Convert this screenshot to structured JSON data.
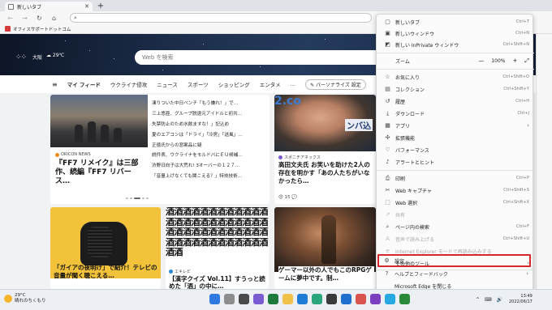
{
  "browser": {
    "tab_title": "新しいタブ",
    "tab_close": "✕",
    "new_tab": "+",
    "address_value": "",
    "nav": {
      "back": "←",
      "forward": "→",
      "refresh": "↻",
      "home": "⌂"
    },
    "favorites_bar": [
      {
        "label": "オフィスサポートドットコム"
      }
    ]
  },
  "hero": {
    "apps_glyph": "⁘⁘",
    "city": "大阪",
    "weather": "☁ 29℃",
    "search_placeholder": "Web を検索"
  },
  "feed_nav": {
    "menu_glyph": "≡",
    "items": [
      "マイ フィード",
      "ウクライナ侵攻",
      "ニュース",
      "スポーツ",
      "ショッピング",
      "エンタメ",
      "…"
    ],
    "personalize": "✎ パーソナライズ 設定"
  },
  "cards": {
    "ff7": {
      "source": "ORICON NEWS",
      "headline": "『FF7 リメイク』は三部作、続編『FF7 リバース…"
    },
    "news_list": [
      "凍りついた中日ベンチ「もう嫌れ！」で…",
      "三上悠亜、グループ脱退元アイドルと初共…",
      "失禁防止のため水飲ますな！」記込め",
      "夏のエアコンは「ドライ」「冷房」「送風」…",
      "正徳氏からの窓案品に疑",
      "説件表、ウクライナをモルドバにＥＵ候補…",
      "渋野日向子は大荒れ! 3オーバーの１２７…",
      "「音量上げなくても聞こえる？」特技技術…"
    ],
    "man": {
      "brand": "2.co",
      "sign": "ンバ込",
      "source": "スポニチアネックス",
      "headline": "高田文夫氏 お笑いを助けた2人の存在を明かす「あの人たちがいなかったら…",
      "reactions": "😍 15   💬"
    },
    "speaker": {
      "headline": "「ガイアの夜明け」で紹介！テレビの音量が聞く聴こえる…"
    },
    "kanji": {
      "pattern": "酒酒酒酒酒酒酒酒酒酒酒酒酒酒酒酒酒酒酒酒酒酒酒酒酒酒酒酒酒酒酒酒酒酒酒酒酒酒酒酒酒酒酒酒酒酒酒酒酒酒",
      "source": "エキレビ",
      "headline": "【漢字クイズ Vol.11】すうっと読めた「酒」の中に…"
    },
    "game": {
      "headline": "ゲーマー以外の人でもこのRPGゲームに夢中です。制…"
    }
  },
  "menu": {
    "items": [
      {
        "icon": "▢",
        "label": "新しいタブ",
        "shortcut": "Ctrl+T"
      },
      {
        "icon": "▣",
        "label": "新しいウィンドウ",
        "shortcut": "Ctrl+N"
      },
      {
        "icon": "◩",
        "label": "新しい InPrivate ウィンドウ",
        "shortcut": "Ctrl+Shift+N"
      },
      {
        "icon": "",
        "label": "ズーム",
        "zoom": "100%"
      },
      {
        "icon": "☆",
        "label": "お気に入り",
        "shortcut": "Ctrl+Shift+O"
      },
      {
        "icon": "▤",
        "label": "コレクション",
        "shortcut": "Ctrl+Shift+Y"
      },
      {
        "icon": "↺",
        "label": "履歴",
        "shortcut": "Ctrl+H"
      },
      {
        "icon": "⤓",
        "label": "ダウンロード",
        "shortcut": "Ctrl+J"
      },
      {
        "icon": "▦",
        "label": "アプリ",
        "arrow": "›"
      },
      {
        "icon": "✣",
        "label": "拡張機能"
      },
      {
        "icon": "♡",
        "label": "パフォーマンス"
      },
      {
        "icon": "♪",
        "label": "アラートとヒント"
      },
      {
        "icon": "⎙",
        "label": "印刷",
        "shortcut": "Ctrl+P"
      },
      {
        "icon": "✂",
        "label": "Web キャプチャ",
        "shortcut": "Ctrl+Shift+S"
      },
      {
        "icon": "⬚",
        "label": "Web 選択",
        "shortcut": "Ctrl+Shift+X"
      },
      {
        "icon": "↗",
        "label": "共有",
        "disabled": true
      },
      {
        "icon": "⌕",
        "label": "ページ内の検索",
        "shortcut": "Ctrl+F"
      },
      {
        "icon": "A",
        "label": "音声で読み上げる",
        "shortcut": "Ctrl+Shift+U",
        "disabled": true
      },
      {
        "icon": "e",
        "label": "Internet Explorer モードで再読み込みする",
        "disabled": true
      },
      {
        "icon": "",
        "label": "その他のツール",
        "arrow": "›"
      },
      {
        "icon": "⚙",
        "label": "設定"
      },
      {
        "icon": "?",
        "label": "ヘルプとフィードバック",
        "arrow": "›"
      },
      {
        "icon": "",
        "label": "Microsoft Edge を閉じる"
      }
    ],
    "zoom_minus": "—",
    "zoom_plus": "+",
    "zoom_full": "⤢"
  },
  "taskbar": {
    "temp": "29°C",
    "weather_desc": "晴れのちくもり",
    "tray": "^ ⌨ 🔊",
    "time": "13:49",
    "date": "2022/06/17"
  },
  "colors": {
    "highlight": "#d5282c",
    "hero_bg": "#1b2c48"
  }
}
